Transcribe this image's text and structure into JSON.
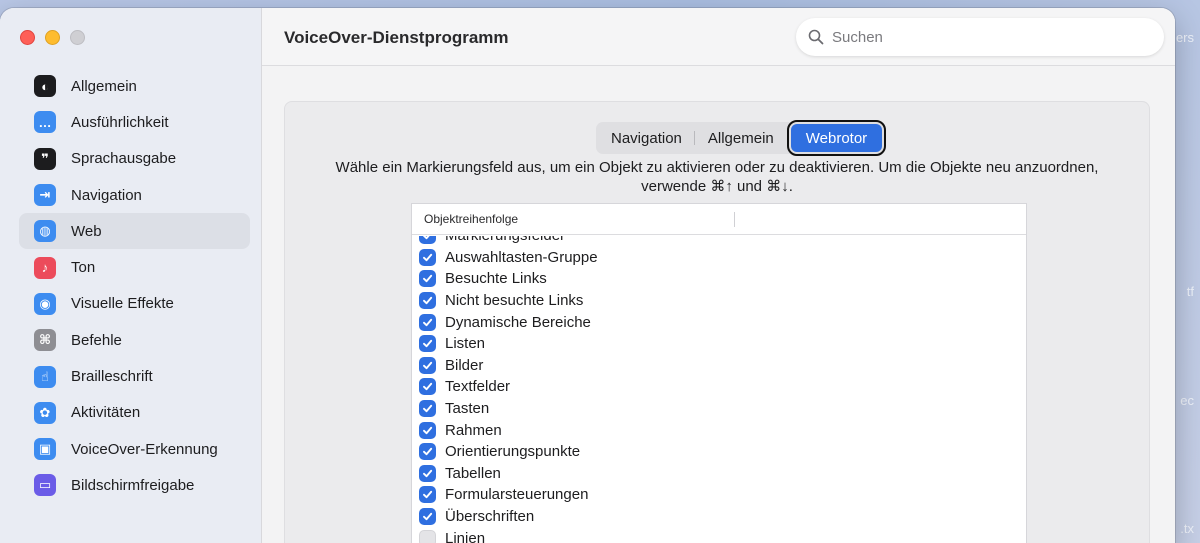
{
  "desktop": {
    "edge_texts": [
      "ers",
      "tf",
      "ec",
      ".tx"
    ]
  },
  "window": {
    "title": "VoiceOver-Dienstprogramm",
    "search": {
      "placeholder": "Suchen",
      "value": ""
    }
  },
  "sidebar": {
    "items": [
      {
        "label": "Allgemein",
        "icon": "voiceover-general-icon",
        "color": "#1c1c1e",
        "glyph": "◐",
        "active": false
      },
      {
        "label": "Ausführlichkeit",
        "icon": "speech-bubble-icon",
        "color": "#3d8cf0",
        "glyph": "…",
        "active": false
      },
      {
        "label": "Sprachausgabe",
        "icon": "speech-output-icon",
        "color": "#1c1c1e",
        "glyph": "❞",
        "active": false
      },
      {
        "label": "Navigation",
        "icon": "navigation-arrow-icon",
        "color": "#3d8cf0",
        "glyph": "⇥",
        "active": false
      },
      {
        "label": "Web",
        "icon": "globe-icon",
        "color": "#3d8cf0",
        "glyph": "◍",
        "active": true
      },
      {
        "label": "Ton",
        "icon": "speaker-icon",
        "color": "#ec4b5b",
        "glyph": "♪",
        "active": false
      },
      {
        "label": "Visuelle Effekte",
        "icon": "eye-icon",
        "color": "#3d8cf0",
        "glyph": "◉",
        "active": false
      },
      {
        "label": "Befehle",
        "icon": "command-icon",
        "color": "#8e8e93",
        "glyph": "⌘",
        "active": false
      },
      {
        "label": "Brailleschrift",
        "icon": "braille-hand-icon",
        "color": "#3d8cf0",
        "glyph": "☝",
        "active": false
      },
      {
        "label": "Aktivitäten",
        "icon": "activities-icon",
        "color": "#3d8cf0",
        "glyph": "✿",
        "active": false
      },
      {
        "label": "VoiceOver-Erkennung",
        "icon": "image-recognition-icon",
        "color": "#3d8cf0",
        "glyph": "▣",
        "active": false
      },
      {
        "label": "Bildschirmfreigabe",
        "icon": "screen-sharing-icon",
        "color": "#6b5ce7",
        "glyph": "▭",
        "active": false
      }
    ]
  },
  "tabs": [
    {
      "label": "Navigation",
      "selected": false
    },
    {
      "label": "Allgemein",
      "selected": false
    },
    {
      "label": "Webrotor",
      "selected": true
    }
  ],
  "instructions": {
    "line1": "Wähle ein Markierungsfeld aus, um ein Objekt zu aktivieren oder zu deaktivieren. Um die Objekte neu anzuordnen,",
    "line2": "verwende ⌘↑ und ⌘↓."
  },
  "table": {
    "header": "Objektreihenfolge",
    "rows": [
      {
        "label": "Markierungsfelder",
        "checked": true
      },
      {
        "label": "Auswahltasten-Gruppe",
        "checked": true
      },
      {
        "label": "Besuchte Links",
        "checked": true
      },
      {
        "label": "Nicht besuchte Links",
        "checked": true
      },
      {
        "label": "Dynamische Bereiche",
        "checked": true
      },
      {
        "label": "Listen",
        "checked": true
      },
      {
        "label": "Bilder",
        "checked": true
      },
      {
        "label": "Textfelder",
        "checked": true
      },
      {
        "label": "Tasten",
        "checked": true
      },
      {
        "label": "Rahmen",
        "checked": true
      },
      {
        "label": "Orientierungspunkte",
        "checked": true
      },
      {
        "label": "Tabellen",
        "checked": true
      },
      {
        "label": "Formularsteuerungen",
        "checked": true
      },
      {
        "label": "Überschriften",
        "checked": true
      },
      {
        "label": "Linien",
        "checked": false
      }
    ]
  }
}
